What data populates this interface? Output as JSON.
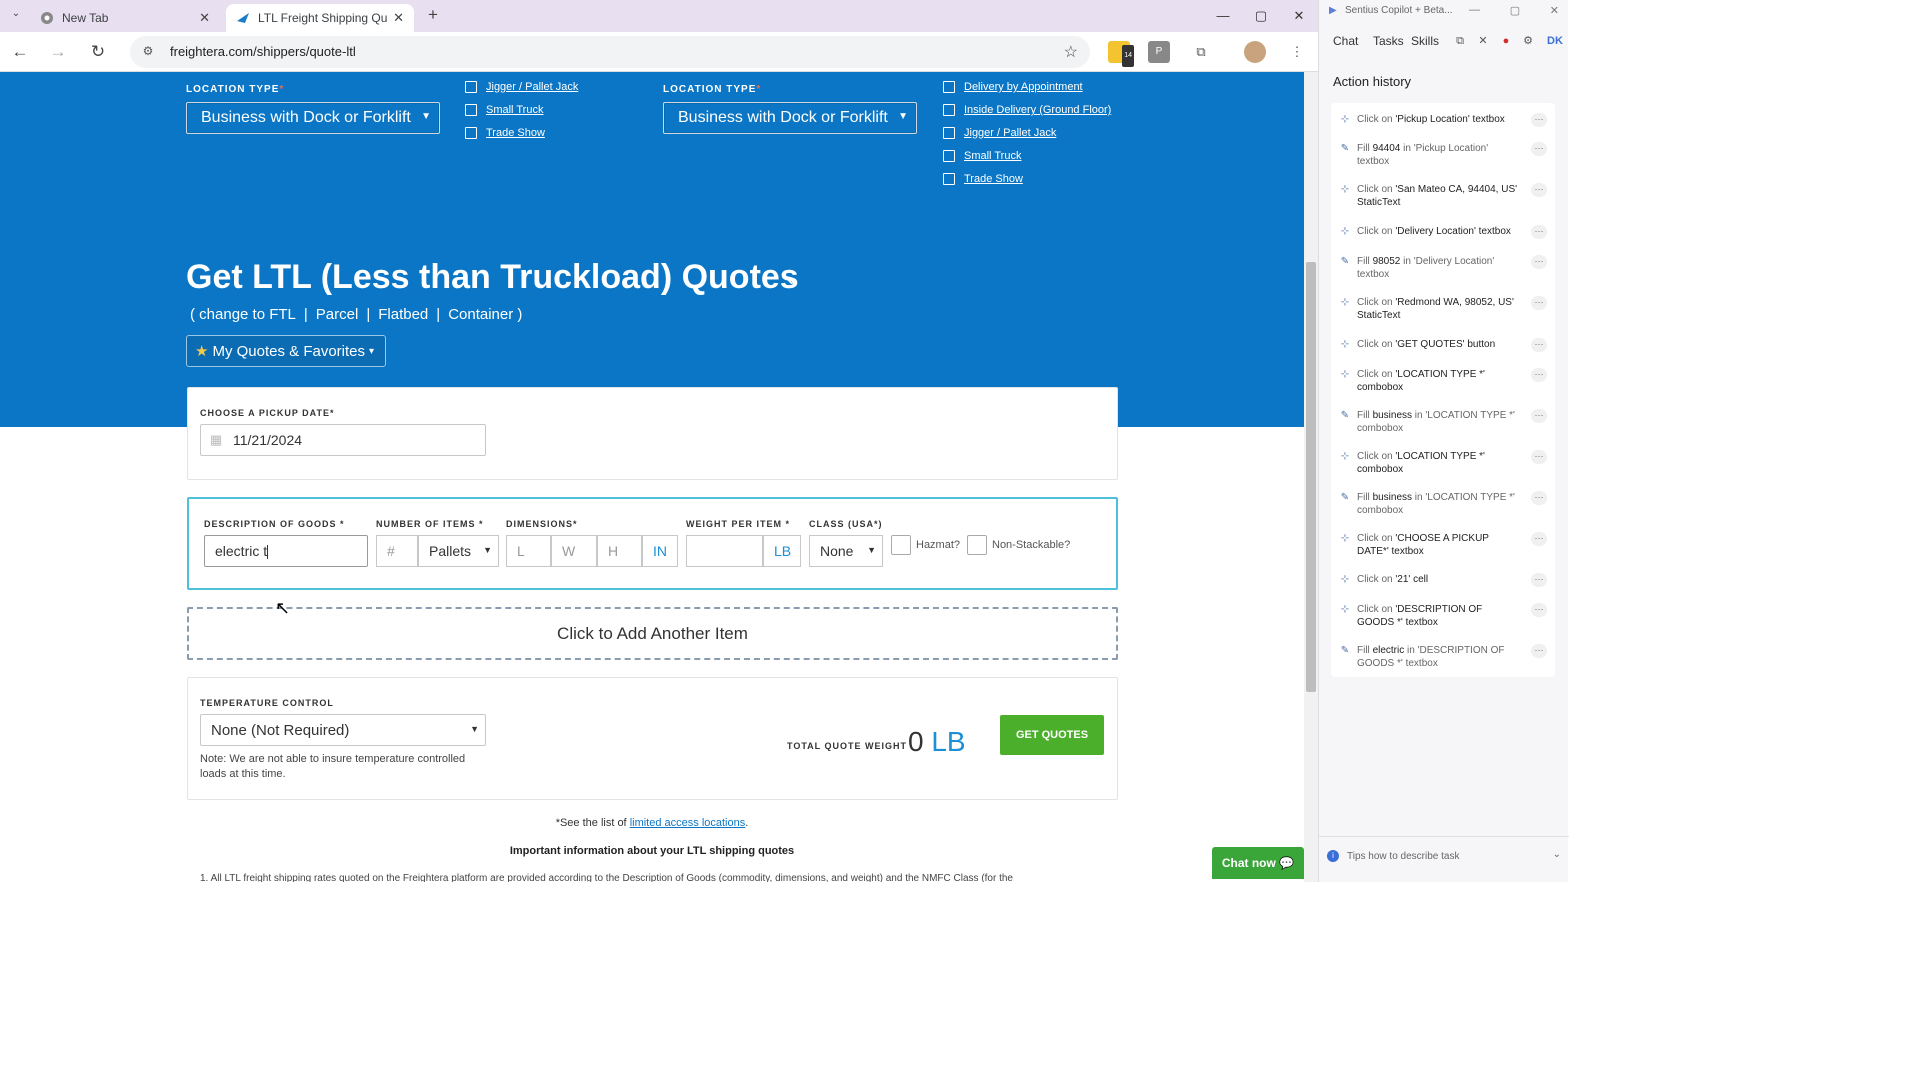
{
  "browser": {
    "tabs": [
      {
        "title": "New Tab",
        "close": "✕"
      },
      {
        "title": "LTL Freight Shipping Quotes",
        "close": "✕"
      }
    ],
    "new_tab": "+",
    "url": "freightera.com/shippers/quote-ltl",
    "ext_badge": "14",
    "window_controls": [
      "—",
      "▢",
      "✕"
    ]
  },
  "origin": {
    "location_type_label": "LOCATION TYPE",
    "required_mark": "*",
    "location_type_value": "Business with Dock or Forklift",
    "accessorials": [
      "Jigger / Pallet Jack",
      "Small Truck",
      "Trade Show"
    ]
  },
  "destination": {
    "location_type_label": "LOCATION TYPE",
    "required_mark": "*",
    "location_type_value": "Business with Dock or Forklift",
    "accessorials": [
      "Delivery by Appointment",
      "Inside Delivery (Ground Floor)",
      "Jigger / Pallet Jack",
      "Small Truck",
      "Trade Show"
    ]
  },
  "hero": {
    "title": "Get LTL (Less than Truckload) Quotes",
    "alt_open": "( change to FTL",
    "alt_parcel": "Parcel",
    "alt_flatbed": "Flatbed",
    "alt_container": "Container )",
    "sep": "|",
    "favorites": "My Quotes & Favorites"
  },
  "pickup": {
    "label": "CHOOSE A PICKUP DATE",
    "req": "*",
    "value": "11/21/2024"
  },
  "item": {
    "desc_label": "DESCRIPTION OF GOODS",
    "desc_req": " *",
    "desc_value": "electric t",
    "num_label": "NUMBER OF ITEMS",
    "num_req": " *",
    "num_placeholder": "#",
    "num_unit": "Pallets",
    "dim_label": "DIMENSIONS",
    "dim_req": "*",
    "dim_l": "L",
    "dim_w": "W",
    "dim_h": "H",
    "dim_unit": "IN",
    "weight_label": "WEIGHT PER ITEM",
    "weight_req": " *",
    "weight_unit": "LB",
    "class_label": "CLASS (USA",
    "class_req": "*",
    ")": ")",
    "class_close": ")",
    "class_value": "None",
    "hazmat": "Hazmat?",
    "nonstack": "Non-Stackable?"
  },
  "add_item": "Click to Add Another Item",
  "temp": {
    "label": "TEMPERATURE CONTROL",
    "value": "None (Not Required)",
    "note": "Note: We are not able to insure temperature controlled loads at this time."
  },
  "total": {
    "label": "TOTAL QUOTE WEIGHT",
    "value": "0",
    "unit": "LB"
  },
  "get_quotes": "GET QUOTES",
  "footer": {
    "see_prefix": "*See the list of ",
    "see_link": "limited access locations",
    "see_suffix": ".",
    "important": "Important information about your LTL shipping quotes",
    "fine_print": "1. All LTL freight shipping rates quoted on the Freightera platform are provided according to the Description of Goods (commodity, dimensions, and weight) and the NMFC Class (for the"
  },
  "chat_now": "Chat now",
  "panel": {
    "title": "Sentius Copilot + Beta...",
    "tabs": [
      "Chat",
      "Tasks",
      "Skills"
    ],
    "user": "DK",
    "action_history_title": "Action history",
    "actions": [
      {
        "pre": "Click on ",
        "b": "'Pickup Location' textbox",
        "post": ""
      },
      {
        "pre": "Fill ",
        "b": "94404",
        "post": " in 'Pickup Location' textbox"
      },
      {
        "pre": "Click on ",
        "b": "'San Mateo CA, 94404, US' StaticText",
        "post": ""
      },
      {
        "pre": "Click on ",
        "b": "'Delivery Location' textbox",
        "post": ""
      },
      {
        "pre": "Fill ",
        "b": "98052",
        "post": " in 'Delivery Location' textbox"
      },
      {
        "pre": "Click on ",
        "b": "'Redmond WA, 98052, US' StaticText",
        "post": ""
      },
      {
        "pre": "Click on ",
        "b": "'GET QUOTES' button",
        "post": ""
      },
      {
        "pre": "Click on ",
        "b": "'LOCATION TYPE *' combobox",
        "post": ""
      },
      {
        "pre": "Fill ",
        "b": "business",
        "post": " in 'LOCATION TYPE *' combobox"
      },
      {
        "pre": "Click on ",
        "b": "'LOCATION TYPE *' combobox",
        "post": ""
      },
      {
        "pre": "Fill ",
        "b": "business",
        "post": " in 'LOCATION TYPE *' combobox"
      },
      {
        "pre": "Click on ",
        "b": "'CHOOSE A PICKUP DATE*' textbox",
        "post": ""
      },
      {
        "pre": "Click on ",
        "b": "'21' cell",
        "post": ""
      },
      {
        "pre": "Click on ",
        "b": "'DESCRIPTION OF GOODS *' textbox",
        "post": ""
      },
      {
        "pre": "Fill ",
        "b": "electric",
        "post": " in 'DESCRIPTION OF GOODS *' textbox"
      }
    ],
    "tips": "Tips how to describe task"
  }
}
